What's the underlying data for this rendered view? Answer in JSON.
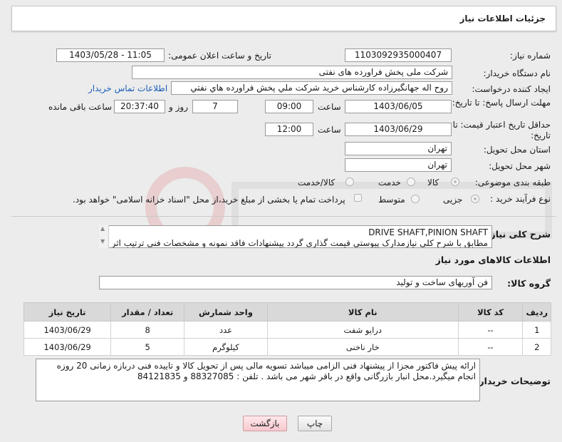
{
  "header": {
    "title": "جزئیات اطلاعات نیاز"
  },
  "fields": {
    "need_number_label": "شماره نیاز:",
    "need_number": "1103092935000407",
    "announce_label": "تاریخ و ساعت اعلان عمومی:",
    "announce_value": "1403/05/28 - 11:05",
    "buyer_org_label": "نام دستگاه خریدار:",
    "buyer_org": "شرکت ملی پخش فراورده های نفتی",
    "requester_label": "ایجاد کننده درخواست:",
    "requester": "روح اله جهانگیرزاده کارشناس خرید شرکت ملي پخش فراورده هاي نفتي",
    "contact_link": "اطلاعات تماس خریدار",
    "reply_deadline_label": "مهلت ارسال پاسخ: تا تاریخ:",
    "reply_date": "1403/06/05",
    "time_label": "ساعت",
    "reply_time": "09:00",
    "days_value": "7",
    "days_label": "روز و",
    "remaining_time": "20:37:40",
    "remaining_label": "ساعت باقی مانده",
    "price_validity_label": "حداقل تاریخ اعتبار قیمت: تا تاریخ:",
    "price_date": "1403/06/29",
    "price_time": "12:00",
    "province_label": "استان محل تحویل:",
    "province": "تهران",
    "city_label": "شهر محل تحویل:",
    "city": "تهران",
    "category_label": "طبقه بندی موضوعی:",
    "category_goods": "کالا",
    "category_service": "خدمت",
    "category_goods_service": "کالا/خدمت",
    "process_label": "نوع فرآیند خرید :",
    "process_minor": "جزیی",
    "process_medium": "متوسط",
    "payment_note": "پرداخت تمام یا بخشی از مبلغ خرید،از محل \"اسناد خزانه اسلامی\" خواهد بود."
  },
  "summary": {
    "label": "شرح کلی نیاز:",
    "line1": "DRIVE SHAFT,PINION SHAFT",
    "line2": "مطابق با شرح کلی نیازمدارک پیوستی قیمت گذاری گردد پیشنهادات فاقد نمونه و مشخصات فنی ترتیب اثر"
  },
  "goods_info": {
    "title": "اطلاعات کالاهای مورد نیاز",
    "group_label": "گروه کالا:",
    "group_value": "فن آوریهای ساخت و تولید"
  },
  "table": {
    "headers": [
      "ردیف",
      "کد کالا",
      "نام کالا",
      "واحد شمارش",
      "تعداد / مقدار",
      "تاریخ نیاز"
    ],
    "rows": [
      [
        "1",
        "--",
        "درایو شفت",
        "عدد",
        "8",
        "1403/06/29"
      ],
      [
        "2",
        "--",
        "خار ناخنی",
        "کیلوگرم",
        "5",
        "1403/06/29"
      ]
    ]
  },
  "buyer_notes": {
    "label": "توضیحات خریدار:",
    "text": "ارائه پیش فاکتور مجزا از پیشنهاد فنی الزامی میباشد تسویه مالی پس از تحویل کالا و تاییده فنی دربازه زمانی 20 روزه انجام میگیرد.محل انبار بازرگانی واقع در باقر شهر می باشد . تلفن : 88327085 و 84121835"
  },
  "buttons": {
    "print": "چاپ",
    "back": "بازگشت"
  },
  "colors": {
    "link": "#1b5fb8",
    "back_button": "#f7c9ce",
    "table_header": "#d9d9d9"
  }
}
